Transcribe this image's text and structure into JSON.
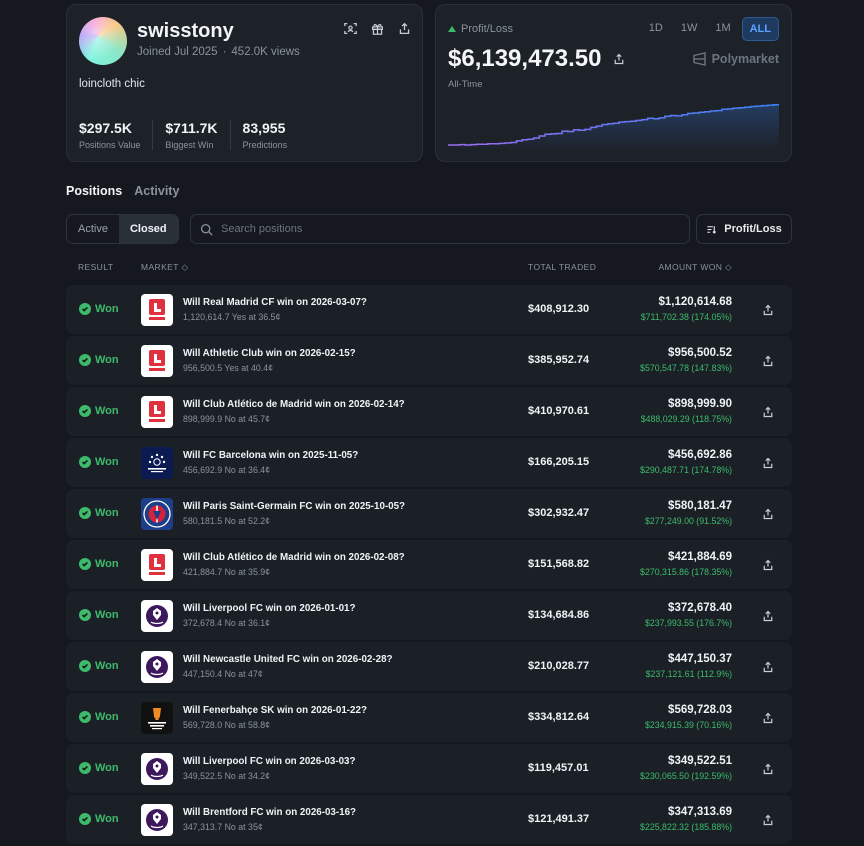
{
  "profile": {
    "username": "swisstony",
    "joined": "Joined Jul 2025",
    "views": "452.0K views",
    "bio": "loincloth chic",
    "stats": [
      {
        "value": "$297.5K",
        "label": "Positions Value"
      },
      {
        "value": "$711.7K",
        "label": "Biggest Win"
      },
      {
        "value": "83,955",
        "label": "Predictions"
      }
    ],
    "icons": [
      "scan-icon",
      "gift-icon",
      "share-icon"
    ]
  },
  "pnl": {
    "title": "Profit/Loss",
    "value": "$6,139,473.50",
    "period": "All-Time",
    "ranges": [
      "1D",
      "1W",
      "1M",
      "ALL"
    ],
    "active_range": "ALL",
    "brand": "Polymarket",
    "colors": {
      "line_start": "#9b6cf0",
      "line_end": "#3b82f6",
      "positive": "#3dbb6a",
      "accent": "#5aa2ff"
    },
    "series": [
      0.0,
      0.0,
      0.01,
      0.0,
      0.01,
      0.02,
      0.02,
      0.03,
      0.03,
      0.04,
      0.05,
      0.06,
      0.1,
      0.13,
      0.14,
      0.17,
      0.22,
      0.26,
      0.27,
      0.28,
      0.34,
      0.33,
      0.37,
      0.36,
      0.38,
      0.43,
      0.46,
      0.5,
      0.52,
      0.53,
      0.56,
      0.57,
      0.58,
      0.6,
      0.62,
      0.65,
      0.64,
      0.66,
      0.7,
      0.72,
      0.71,
      0.74,
      0.77,
      0.78,
      0.8,
      0.81,
      0.83,
      0.84,
      0.87,
      0.88,
      0.9,
      0.91,
      0.92,
      0.94,
      0.95,
      0.96,
      0.97,
      0.98,
      1.0
    ]
  },
  "tabs": [
    "Positions",
    "Activity"
  ],
  "filters": {
    "active": "Active",
    "closed": "Closed"
  },
  "search": {
    "placeholder": "Search positions"
  },
  "sort": {
    "label": "Profit/Loss"
  },
  "table": {
    "headers": {
      "result": "RESULT",
      "market": "MARKET",
      "traded": "TOTAL TRADED",
      "won": "AMOUNT WON"
    },
    "rows": [
      {
        "result": "Won",
        "logo": "laliga",
        "title": "Will Real Madrid CF win on 2026-03-07?",
        "sub": "1,120,614.7 Yes at 36.5¢",
        "traded": "$408,912.30",
        "won": "$1,120,614.68",
        "pnl": "$711,702.38 (174.05%)"
      },
      {
        "result": "Won",
        "logo": "laliga",
        "title": "Will Athletic Club win on 2026-02-15?",
        "sub": "956,500.5 Yes at 40.4¢",
        "traded": "$385,952.74",
        "won": "$956,500.52",
        "pnl": "$570,547.78 (147.83%)"
      },
      {
        "result": "Won",
        "logo": "laliga",
        "title": "Will Club Atlético de Madrid win on 2026-02-14?",
        "sub": "898,999.9 No at 45.7¢",
        "traded": "$410,970.61",
        "won": "$898,999.90",
        "pnl": "$488,029.29 (118.75%)"
      },
      {
        "result": "Won",
        "logo": "ucl",
        "title": "Will FC Barcelona win on 2025-11-05?",
        "sub": "456,692.9 No at 36.4¢",
        "traded": "$166,205.15",
        "won": "$456,692.86",
        "pnl": "$290,487.71 (174.78%)"
      },
      {
        "result": "Won",
        "logo": "psg",
        "title": "Will Paris Saint-Germain FC win on 2025-10-05?",
        "sub": "580,181.5 No at 52.2¢",
        "traded": "$302,932.47",
        "won": "$580,181.47",
        "pnl": "$277,249.00 (91.52%)"
      },
      {
        "result": "Won",
        "logo": "laliga",
        "title": "Will Club Atlético de Madrid win on 2026-02-08?",
        "sub": "421,884.7 No at 35.9¢",
        "traded": "$151,568.82",
        "won": "$421,884.69",
        "pnl": "$270,315.86 (178.35%)"
      },
      {
        "result": "Won",
        "logo": "pl",
        "title": "Will Liverpool FC win on 2026-01-01?",
        "sub": "372,678.4 No at 36.1¢",
        "traded": "$134,684.86",
        "won": "$372,678.40",
        "pnl": "$237,993.55 (176.7%)"
      },
      {
        "result": "Won",
        "logo": "pl",
        "title": "Will Newcastle United FC win on 2026-02-28?",
        "sub": "447,150.4 No at 47¢",
        "traded": "$210,028.77",
        "won": "$447,150.37",
        "pnl": "$237,121.61 (112.9%)"
      },
      {
        "result": "Won",
        "logo": "uel",
        "title": "Will Fenerbahçe SK win on 2026-01-22?",
        "sub": "569,728.0 No at 58.8¢",
        "traded": "$334,812.64",
        "won": "$569,728.03",
        "pnl": "$234,915.39 (70.16%)"
      },
      {
        "result": "Won",
        "logo": "pl",
        "title": "Will Liverpool FC win on 2026-03-03?",
        "sub": "349,522.5 No at 34.2¢",
        "traded": "$119,457.01",
        "won": "$349,522.51",
        "pnl": "$230,065.50 (192.59%)"
      },
      {
        "result": "Won",
        "logo": "pl",
        "title": "Will Brentford FC win on 2026-03-16?",
        "sub": "347,313.7 No at 35¢",
        "traded": "$121,491.37",
        "won": "$347,313.69",
        "pnl": "$225,822.32 (185.88%)"
      }
    ]
  }
}
